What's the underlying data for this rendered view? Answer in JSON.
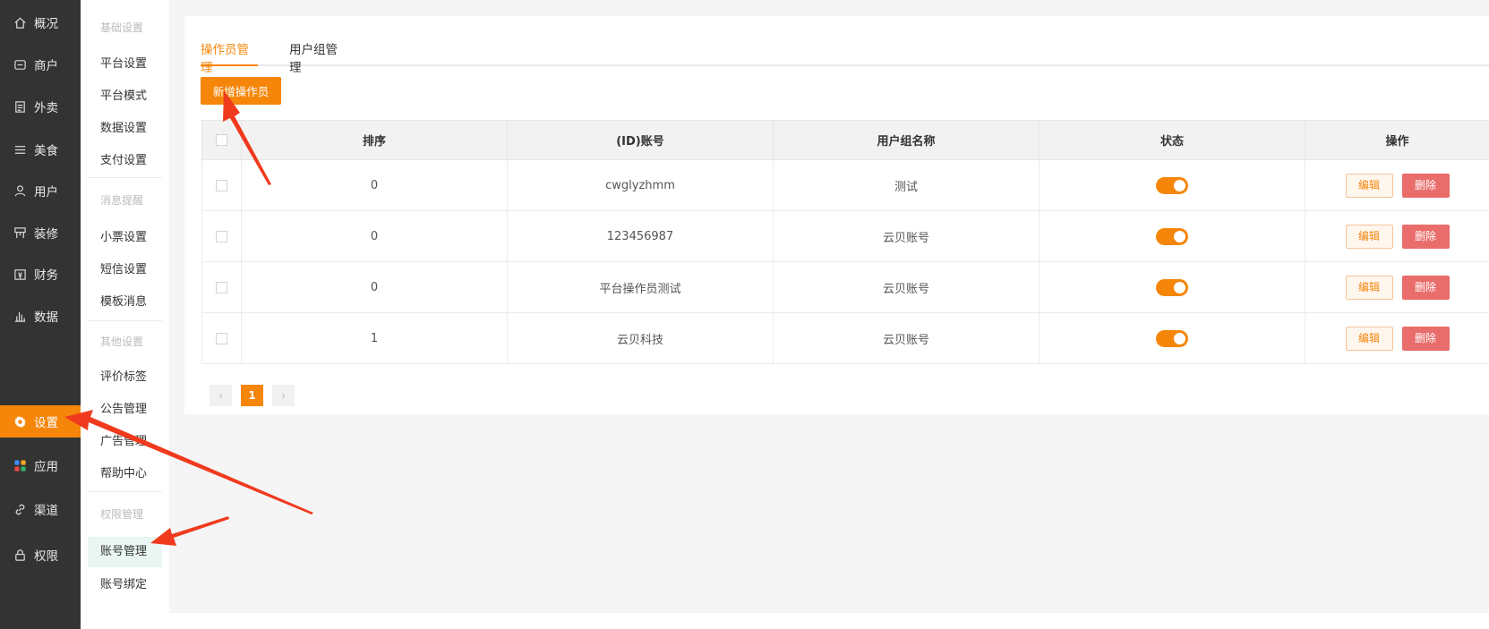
{
  "nav": {
    "items": [
      {
        "label": "概况",
        "icon": "home-icon"
      },
      {
        "label": "商户",
        "icon": "store-icon"
      },
      {
        "label": "外卖",
        "icon": "document-icon"
      },
      {
        "label": "美食",
        "icon": "menu-icon"
      },
      {
        "label": "用户",
        "icon": "user-icon"
      },
      {
        "label": "装修",
        "icon": "decorate-icon"
      },
      {
        "label": "财务",
        "icon": "finance-icon"
      },
      {
        "label": "数据",
        "icon": "bar-chart-icon"
      },
      {
        "label": "设置",
        "icon": "gear-icon"
      },
      {
        "label": "应用",
        "icon": "apps-icon"
      },
      {
        "label": "渠道",
        "icon": "link-icon"
      },
      {
        "label": "权限",
        "icon": "lock-icon"
      }
    ],
    "active": "设置",
    "accent": "#f5860a",
    "background": "#333333"
  },
  "submenu": {
    "groups": [
      {
        "title": "基础设置",
        "items": [
          "平台设置",
          "平台模式",
          "数据设置",
          "支付设置"
        ]
      },
      {
        "title": "消息提醒",
        "items": [
          "小票设置",
          "短信设置",
          "模板消息"
        ]
      },
      {
        "title": "其他设置",
        "items": [
          "评价标签",
          "公告管理",
          "广告管理",
          "帮助中心"
        ]
      },
      {
        "title": "权限管理",
        "items": [
          "账号管理",
          "账号绑定"
        ]
      }
    ],
    "active": "账号管理"
  },
  "tabs": [
    {
      "label": "操作员管理",
      "active": true
    },
    {
      "label": "用户组管理",
      "active": false
    }
  ],
  "add_button": "新增操作员",
  "table": {
    "headers": [
      "排序",
      "(ID)账号",
      "用户组名称",
      "状态",
      "操作"
    ],
    "rows": [
      {
        "sort": "0",
        "account": "cwglyzhmm",
        "group": "测试",
        "status_on": true
      },
      {
        "sort": "0",
        "account": "123456987",
        "group": "云贝账号",
        "status_on": true
      },
      {
        "sort": "0",
        "account": "平台操作员测试",
        "group": "云贝账号",
        "status_on": true
      },
      {
        "sort": "1",
        "account": "云贝科技",
        "group": "云贝账号",
        "status_on": true
      }
    ],
    "edit_label": "编辑",
    "delete_label": "删除"
  },
  "pagination": {
    "current": "1",
    "prev": "‹",
    "next": "›"
  },
  "annotation_color": "#f03a1e"
}
